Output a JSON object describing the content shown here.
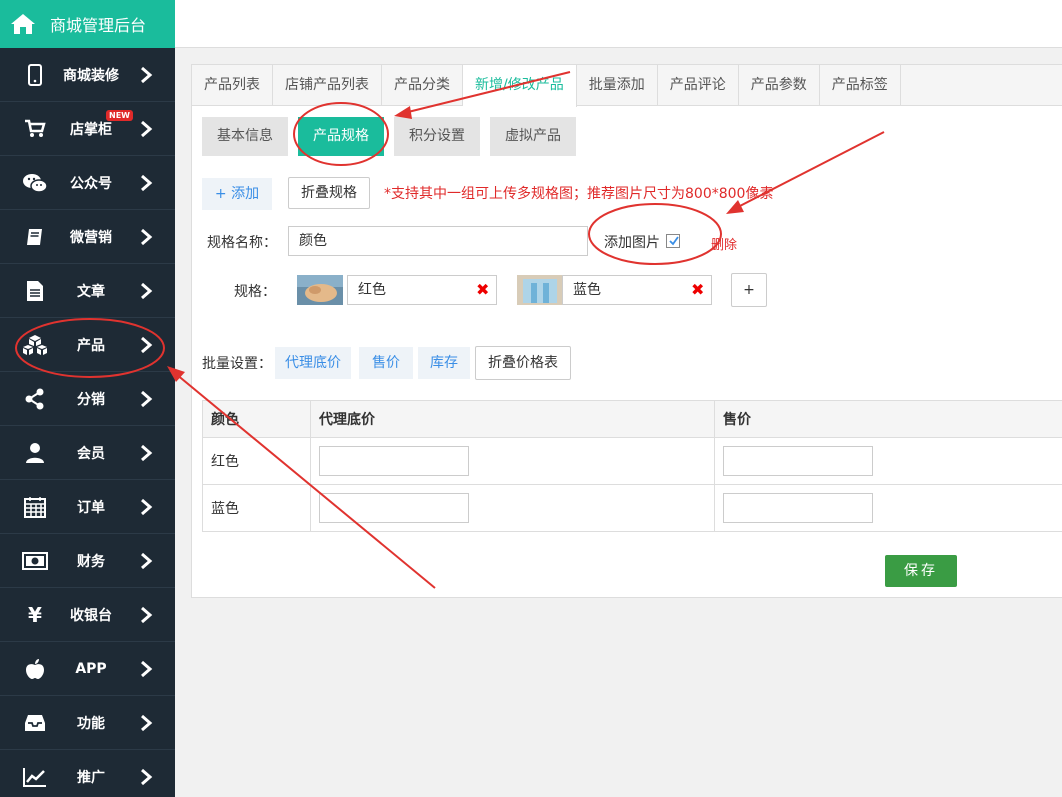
{
  "brand": {
    "title": "商城管理后台",
    "icon": "home-icon",
    "color": "#1abc9c"
  },
  "sidebar": {
    "items": [
      {
        "label": "商城装修",
        "icon": "mobile-icon"
      },
      {
        "label": "店掌柜",
        "icon": "cart-icon",
        "badge": "NEW"
      },
      {
        "label": "公众号",
        "icon": "wechat-icon"
      },
      {
        "label": "微营销",
        "icon": "book-icon"
      },
      {
        "label": "文章",
        "icon": "document-icon"
      },
      {
        "label": "产品",
        "icon": "cubes-icon"
      },
      {
        "label": "分销",
        "icon": "share-icon"
      },
      {
        "label": "会员",
        "icon": "user-icon"
      },
      {
        "label": "订单",
        "icon": "calendar-icon"
      },
      {
        "label": "财务",
        "icon": "money-icon"
      },
      {
        "label": "收银台",
        "icon": "yen-icon"
      },
      {
        "label": "APP",
        "icon": "apple-icon"
      },
      {
        "label": "功能",
        "icon": "inbox-icon"
      },
      {
        "label": "推广",
        "icon": "chart-icon"
      }
    ]
  },
  "tabs": [
    {
      "label": "产品列表"
    },
    {
      "label": "店铺产品列表"
    },
    {
      "label": "产品分类"
    },
    {
      "label": "新增/修改产品",
      "active": true
    },
    {
      "label": "批量添加"
    },
    {
      "label": "产品评论"
    },
    {
      "label": "产品参数"
    },
    {
      "label": "产品标签"
    }
  ],
  "subtabs": [
    {
      "label": "基本信息"
    },
    {
      "label": "产品规格",
      "active": true
    },
    {
      "label": "积分设置"
    },
    {
      "label": "虚拟产品"
    }
  ],
  "spec": {
    "add_label": "+ 添加",
    "fold_label": "折叠规格",
    "hint": "*支持其中一组可上传多规格图；推荐图片尺寸为800*800像素",
    "name_label": "规格名称：",
    "name_value": "颜色",
    "add_image_label": "添加图片",
    "add_image_checked": true,
    "delete_label": "删除",
    "values_label": "规格：",
    "values": [
      {
        "value": "红色"
      },
      {
        "value": "蓝色"
      }
    ],
    "add_value_label": "+"
  },
  "batch": {
    "label": "批量设置：",
    "agent_price": "代理底价",
    "sale_price": "售价",
    "stock": "库存",
    "fold_price": "折叠价格表"
  },
  "price_table": {
    "headers": [
      "颜色",
      "代理底价",
      "售价"
    ],
    "rows": [
      {
        "name": "红色",
        "agent_price": "",
        "sale_price": ""
      },
      {
        "name": "蓝色",
        "agent_price": "",
        "sale_price": ""
      }
    ]
  },
  "save_label": "保存",
  "colors": {
    "accent": "#1abc9c",
    "sidebar": "#1e2a35",
    "save": "#3a9c44",
    "annotation": "#e0332f"
  }
}
